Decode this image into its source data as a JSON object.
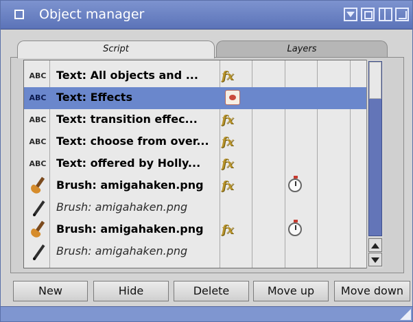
{
  "window": {
    "title": "Object manager"
  },
  "tabs": [
    {
      "label": "Script",
      "active": true
    },
    {
      "label": "Layers",
      "active": false
    }
  ],
  "list": {
    "rows": [
      {
        "type": "ABC",
        "name": "Text: All objects and ...",
        "effect": "fx",
        "timer": false,
        "selected": false
      },
      {
        "type": "ABC",
        "name": "Text: Effects",
        "effect": "image",
        "timer": false,
        "selected": true
      },
      {
        "type": "ABC",
        "name": "Text: transition effec...",
        "effect": "fx",
        "timer": false,
        "selected": false
      },
      {
        "type": "ABC",
        "name": "Text: choose from over...",
        "effect": "fx",
        "timer": false,
        "selected": false
      },
      {
        "type": "ABC",
        "name": "Text: offered by Holly...",
        "effect": "fx",
        "timer": false,
        "selected": false
      },
      {
        "type": "brush-icon",
        "name": "Brush: amigahaken.png",
        "effect": "fx",
        "timer": true,
        "selected": false
      },
      {
        "type": "pen-icon",
        "name": "Brush: amigahaken.png",
        "effect": "",
        "timer": false,
        "selected": false,
        "italic": true
      },
      {
        "type": "brush-icon",
        "name": "Brush: amigahaken.png",
        "effect": "fx",
        "timer": true,
        "selected": false
      },
      {
        "type": "pen-icon",
        "name": "Brush: amigahaken.png",
        "effect": "",
        "timer": false,
        "selected": false,
        "italic": true
      }
    ]
  },
  "buttons": {
    "new": "New",
    "hide": "Hide",
    "delete": "Delete",
    "move_up": "Move up",
    "move_down": "Move down"
  },
  "colors": {
    "title_bar": "#6f87c8",
    "selection": "#6a87cc",
    "fx_gold": "#b8932a",
    "scroll_track": "#6375b8"
  }
}
